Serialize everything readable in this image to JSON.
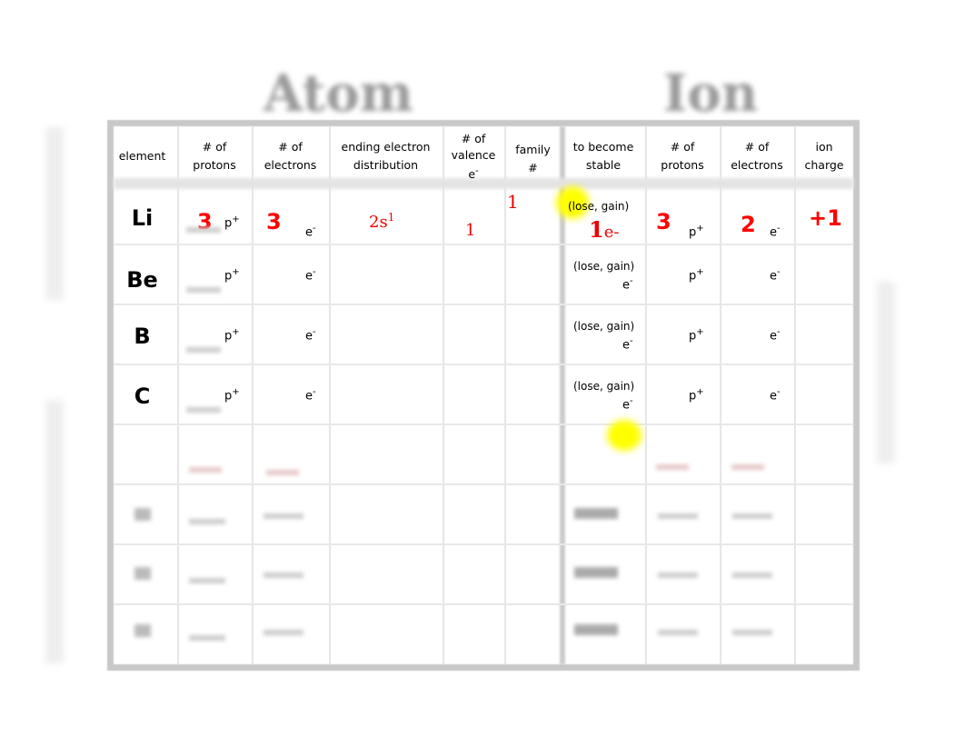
{
  "titles": {
    "atom": "Atom",
    "ion": "Ion"
  },
  "headers": [
    "element",
    "# of protons",
    "# of electrons",
    "ending electron distribution",
    "# of valence e-",
    "family #",
    "to become stable",
    "# of protons",
    "# of electrons",
    "ion charge"
  ],
  "header_lines": {
    "h0": [
      "element"
    ],
    "h1": [
      "# of",
      "protons"
    ],
    "h2": [
      "# of",
      "electrons"
    ],
    "h3": [
      "ending electron",
      "distribution"
    ],
    "h4": [
      "# of",
      "valence",
      "e"
    ],
    "h5": [
      "family",
      "#"
    ],
    "h6": [
      "to become",
      "stable"
    ],
    "h7": [
      "# of",
      "protons"
    ],
    "h8": [
      "# of",
      "electrons"
    ],
    "h9": [
      "ion",
      "charge"
    ]
  },
  "units": {
    "proton": "p",
    "proton_sign": "+",
    "electron": "e",
    "electron_sign": "-",
    "lose_gain": "(lose, gain)"
  },
  "rows": [
    {
      "element": "Li",
      "protons": "3",
      "electrons": "3",
      "distribution": "2s",
      "distribution_sup": "1",
      "valence": "1",
      "family": "1",
      "stable_num": "1",
      "stable_unit": "e-",
      "ion_protons": "3",
      "ion_electrons": "2",
      "charge": "+1"
    },
    {
      "element": "Be"
    },
    {
      "element": "B"
    },
    {
      "element": "C"
    }
  ],
  "colors": {
    "answer": "#ff0000",
    "highlight": "#ffff00",
    "border": "#c8c8c8"
  }
}
